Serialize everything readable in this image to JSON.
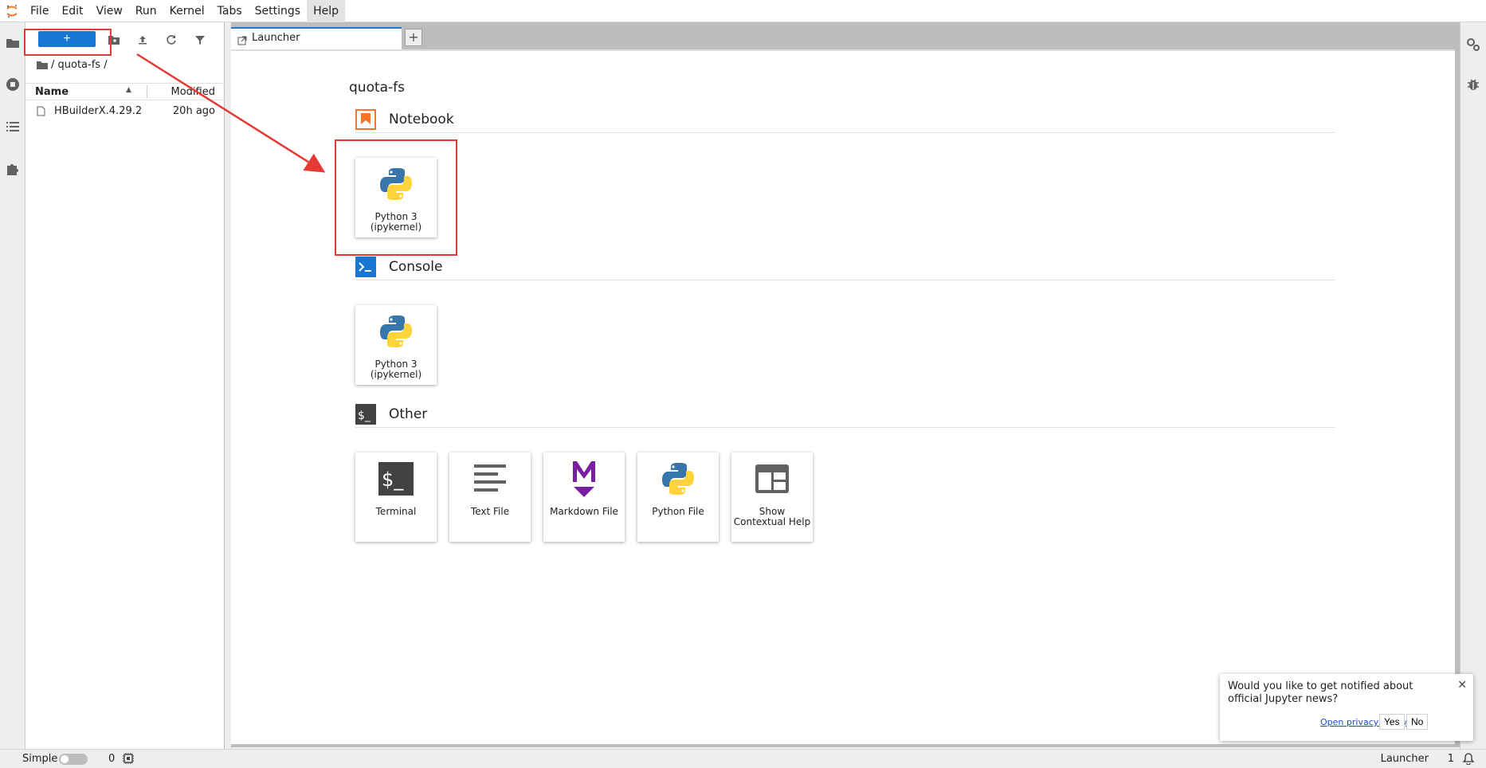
{
  "menubar": {
    "items": [
      "File",
      "Edit",
      "View",
      "Run",
      "Kernel",
      "Tabs",
      "Settings",
      "Help"
    ]
  },
  "filebrowser": {
    "new_label": "+",
    "breadcrumb": "/ quota-fs /",
    "col_name": "Name",
    "col_modified": "Modified",
    "rows": [
      {
        "name": "HBuilderX.4.29.2...",
        "modified": "20h ago"
      }
    ]
  },
  "tab": {
    "label": "Launcher",
    "add_label": "+"
  },
  "launcher": {
    "directory": "quota-fs",
    "sections": [
      {
        "label": "Notebook",
        "icon": "notebook-icon",
        "cards": [
          {
            "label": "Python 3 (ipykernel)",
            "icon": "python-icon"
          }
        ]
      },
      {
        "label": "Console",
        "icon": "console-icon",
        "cards": [
          {
            "label": "Python 3 (ipykernel)",
            "icon": "python-icon"
          }
        ]
      },
      {
        "label": "Other",
        "icon": "terminal-section-icon",
        "cards": [
          {
            "label": "Terminal",
            "icon": "terminal-icon"
          },
          {
            "label": "Text File",
            "icon": "text-file-icon"
          },
          {
            "label": "Markdown File",
            "icon": "markdown-icon"
          },
          {
            "label": "Python File",
            "icon": "python-icon"
          },
          {
            "label": "Show Contextual Help",
            "icon": "contextual-help-icon"
          }
        ]
      }
    ]
  },
  "statusbar": {
    "simple_label": "Simple",
    "kernel_count": "0",
    "active_label": "Launcher",
    "active_count": "1"
  },
  "notification": {
    "message": "Would you like to get notified about official Jupyter news?",
    "privacy_link": "Open privacy policy",
    "yes_label": "Yes",
    "no_label": "No"
  },
  "colors": {
    "accent": "#1976d2",
    "annotation": "#e53935",
    "notebook_orange": "#f37726"
  }
}
